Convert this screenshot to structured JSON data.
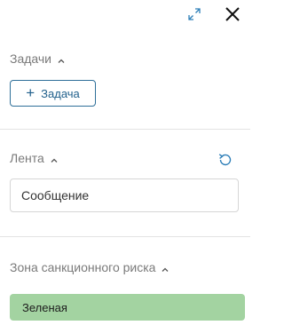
{
  "header": {
    "expand_icon": "expand-arrows-icon",
    "close_icon": "close-x-icon"
  },
  "tasks": {
    "title": "Задачи",
    "add_button_label": "Задача"
  },
  "feed": {
    "title": "Лента",
    "message_placeholder": "Сообщение",
    "refresh_icon": "refresh-icon"
  },
  "sanctions": {
    "title": "Зона санкционного риска",
    "status": "Зеленая",
    "status_color": "#a3d3a1"
  },
  "colors": {
    "accent": "#1f5f8b",
    "muted_text": "#7a7a7a",
    "divider": "#e3e3e3"
  }
}
